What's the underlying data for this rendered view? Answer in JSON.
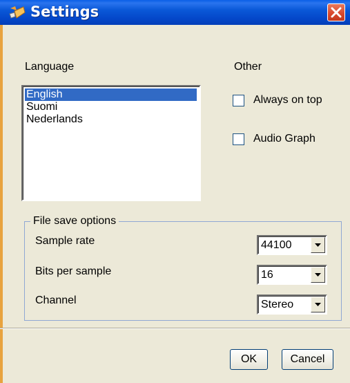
{
  "window": {
    "title": "Settings",
    "close_label": "×"
  },
  "language": {
    "label": "Language",
    "items": [
      "English",
      "Suomi",
      "Nederlands"
    ],
    "selected": "English"
  },
  "other": {
    "label": "Other",
    "always_on_top": {
      "label": "Always on top",
      "checked": false
    },
    "audio_graph": {
      "label": "Audio Graph",
      "checked": false
    }
  },
  "file_save": {
    "title": "File save options",
    "sample_rate": {
      "label": "Sample rate",
      "value": "44100"
    },
    "bits_per_sample": {
      "label": "Bits per sample",
      "value": "16"
    },
    "channel": {
      "label": "Channel",
      "value": "Stereo"
    }
  },
  "buttons": {
    "ok": "OK",
    "cancel": "Cancel"
  },
  "colors": {
    "title_bar": "#0a58d8",
    "selection": "#316ac5",
    "close": "#d8462a",
    "dialog_bg": "#ece9d8"
  },
  "icons": {
    "title": "app-icon",
    "close": "close-icon",
    "dropdown": "chevron-down-icon"
  }
}
